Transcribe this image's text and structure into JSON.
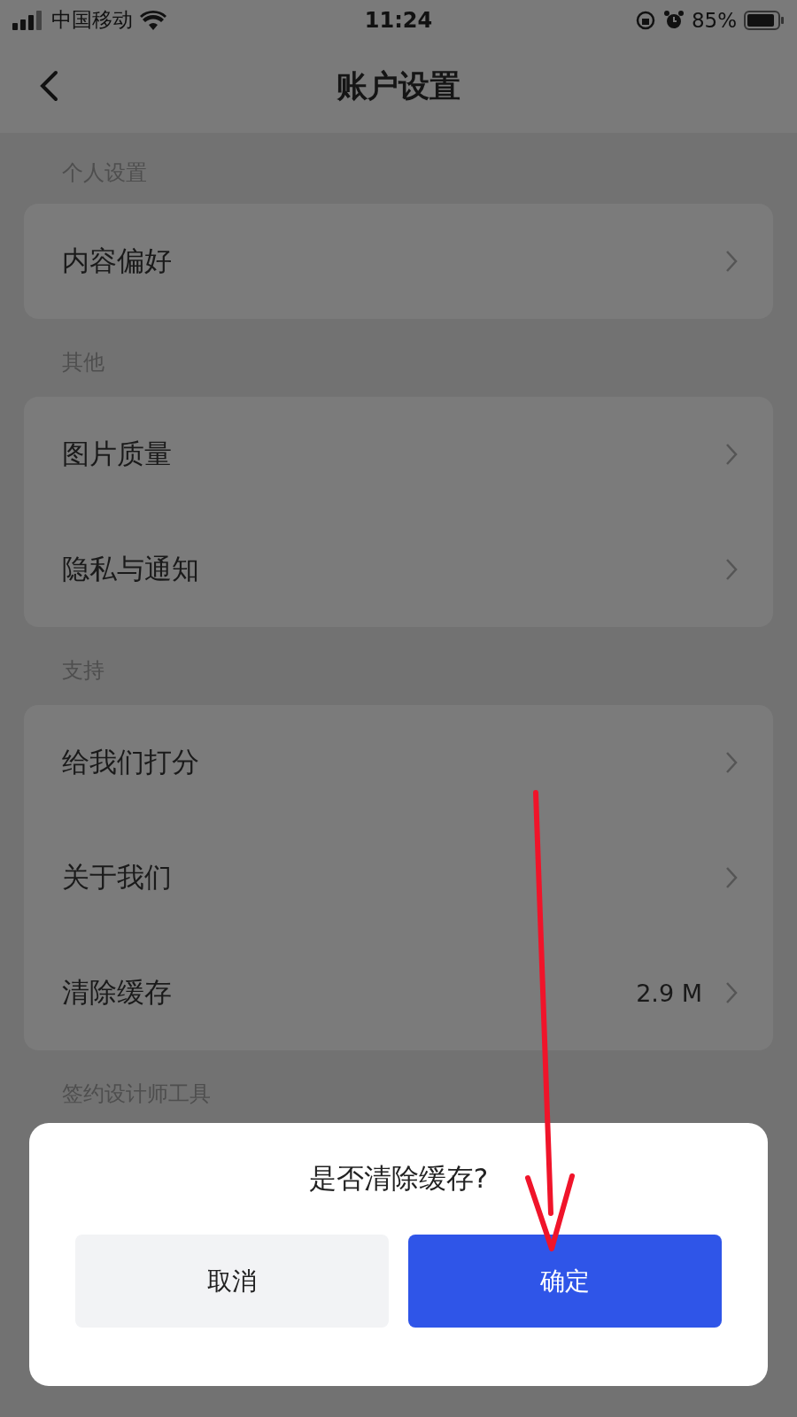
{
  "status_bar": {
    "carrier": "中国移动",
    "time": "11:24",
    "battery": "85%"
  },
  "nav": {
    "title": "账户设置"
  },
  "sections": [
    {
      "title": "个人设置",
      "items": [
        {
          "label": "内容偏好"
        }
      ]
    },
    {
      "title": "其他",
      "items": [
        {
          "label": "图片质量"
        },
        {
          "label": "隐私与通知"
        }
      ]
    },
    {
      "title": "支持",
      "items": [
        {
          "label": "给我们打分"
        },
        {
          "label": "关于我们"
        },
        {
          "label": "清除缓存",
          "value": "2.9 M"
        }
      ]
    },
    {
      "title": "签约设计师工具"
    }
  ],
  "dialog": {
    "title": "是否清除缓存?",
    "buttons": [
      {
        "label": "取消",
        "kind": "secondary"
      },
      {
        "label": "确定",
        "kind": "primary"
      }
    ]
  }
}
